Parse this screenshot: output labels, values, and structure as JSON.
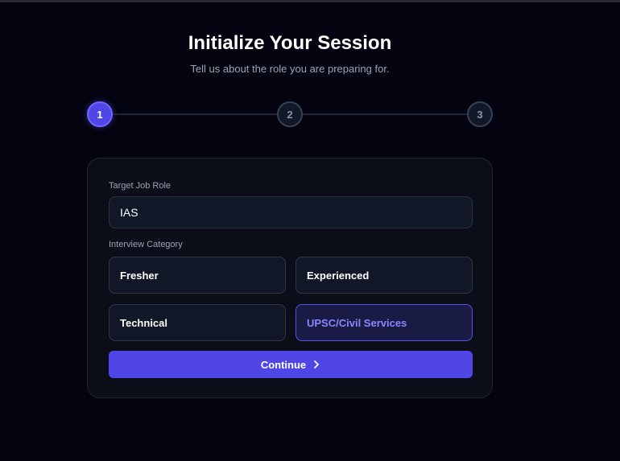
{
  "header": {
    "title": "Initialize Your Session",
    "subtitle": "Tell us about the role you are preparing for."
  },
  "stepper": {
    "steps": [
      "1",
      "2",
      "3"
    ],
    "active_step": 1
  },
  "form": {
    "role_label": "Target Job Role",
    "role_value": "IAS",
    "category_label": "Interview Category",
    "categories": [
      "Fresher",
      "Experienced",
      "Technical",
      "UPSC/Civil Services"
    ],
    "selected_category": "UPSC/Civil Services",
    "continue_label": "Continue",
    "continue_icon": "chevron-right-icon"
  },
  "colors": {
    "accent": "#5046e5",
    "background": "#03040f",
    "card": "#0b0e19",
    "selected_text": "#8a86ff"
  }
}
